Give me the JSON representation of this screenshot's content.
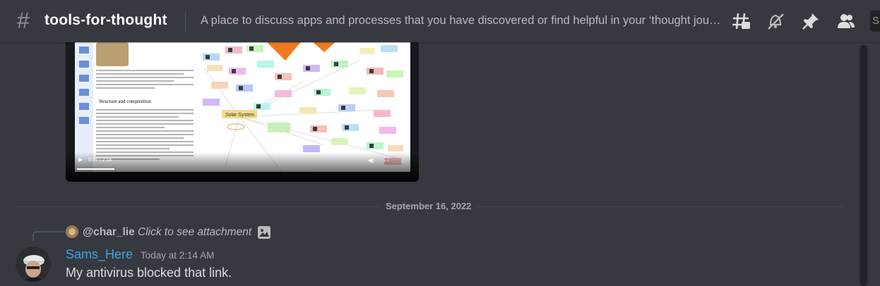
{
  "header": {
    "hash_symbol": "#",
    "channel_name": "tools-for-thought",
    "topic": "A place to discuss apps and processes that you have discovered or find helpful in your ‘thought jour...",
    "icons": [
      "threads-icon",
      "muted-bell-icon",
      "pin-icon",
      "member-list-icon",
      "search-box"
    ],
    "search_glyph": "S"
  },
  "video": {
    "time_label": "0:37 / 2:14",
    "progress_fraction": 0.16,
    "wiki_section_heading": "Structure and composition",
    "map_center_label": "Solar System"
  },
  "date_divider": {
    "label": "September 16, 2022"
  },
  "reply": {
    "username": "@char_lie",
    "text": "Click to see attachment"
  },
  "message": {
    "author": "Sams_Here",
    "timestamp": "Today at 2:14 AM",
    "content": "My antivirus blocked that link."
  },
  "colors": {
    "background": "#36393f",
    "author_color": "#3fa4e8",
    "header_text": "#ffffff",
    "muted_text": "#b9bbbe"
  }
}
